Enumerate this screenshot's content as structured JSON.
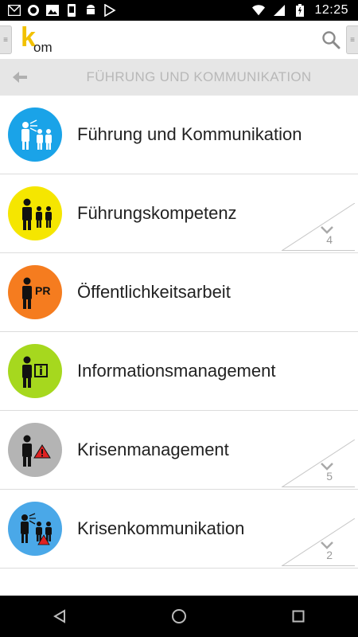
{
  "status_bar": {
    "time": "12:25",
    "left_icons": [
      "gmail-icon",
      "app-icon",
      "image-icon",
      "device-icon",
      "android-icon",
      "play-store-icon"
    ],
    "right_icons": [
      "wifi-icon",
      "signal-icon",
      "battery-icon"
    ]
  },
  "app_bar": {
    "logo_k": "k",
    "logo_om": "om"
  },
  "section": {
    "title": "FÜHRUNG UND KOMMUNIKATION"
  },
  "items": [
    {
      "label": "Führung und Kommunikation",
      "icon": "leadership-communication-icon",
      "color": "#1aa3e8",
      "count": ""
    },
    {
      "label": "Führungskompetenz",
      "icon": "leadership-competence-icon",
      "color": "#f5e600",
      "count": "4"
    },
    {
      "label": "Öffentlichkeitsarbeit",
      "icon": "public-relations-icon",
      "color": "#f57c1f",
      "count": "",
      "badge": "PR"
    },
    {
      "label": "Informationsmanagement",
      "icon": "information-management-icon",
      "color": "#a6d81e",
      "count": ""
    },
    {
      "label": "Krisenmanagement",
      "icon": "crisis-management-icon",
      "color": "#b4b4b4",
      "count": "5"
    },
    {
      "label": "Krisenkommunikation",
      "icon": "crisis-communication-icon",
      "color": "#4aa8e8",
      "count": "2"
    }
  ],
  "colors": {
    "section_bg": "#e6e6e6",
    "section_text": "#b8b8b8",
    "logo_accent": "#f2c100"
  }
}
